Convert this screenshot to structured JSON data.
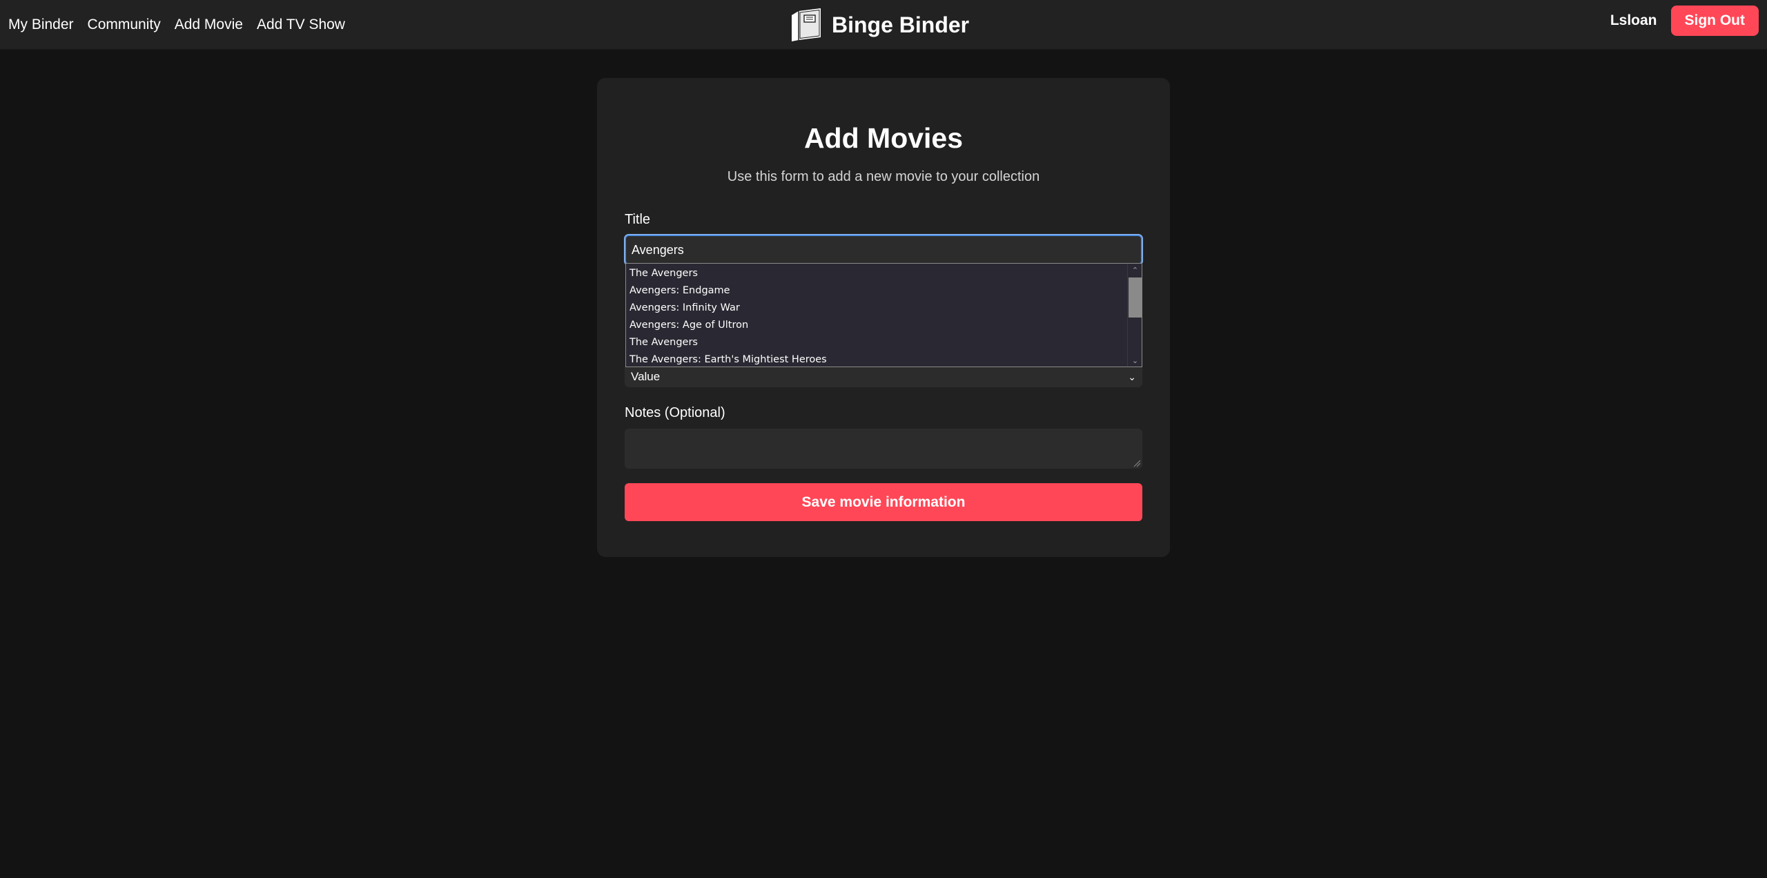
{
  "nav": {
    "links": [
      "My Binder",
      "Community",
      "Add Movie",
      "Add TV Show"
    ],
    "brand": "Binge Binder",
    "brand_icon": "binder-icon",
    "username": "Lsloan",
    "signout_label": "Sign Out"
  },
  "form": {
    "title": "Add Movies",
    "subtitle": "Use this form to add a new movie to your collection",
    "title_label": "Title",
    "title_value": "Avengers",
    "suggestions": [
      "The Avengers",
      "Avengers: Endgame",
      "Avengers: Infinity War",
      "Avengers: Age of Ultron",
      "The Avengers",
      "The Avengers: Earth's Mightiest Heroes"
    ],
    "value_select": "Value",
    "notes_label": "Notes (Optional)",
    "notes_value": "",
    "save_label": "Save movie information"
  },
  "colors": {
    "background": "#131313",
    "navbar": "#222222",
    "card": "#212121",
    "input": "#2c2c2c",
    "accent": "#ff4757",
    "focus": "#4f8fe6"
  }
}
